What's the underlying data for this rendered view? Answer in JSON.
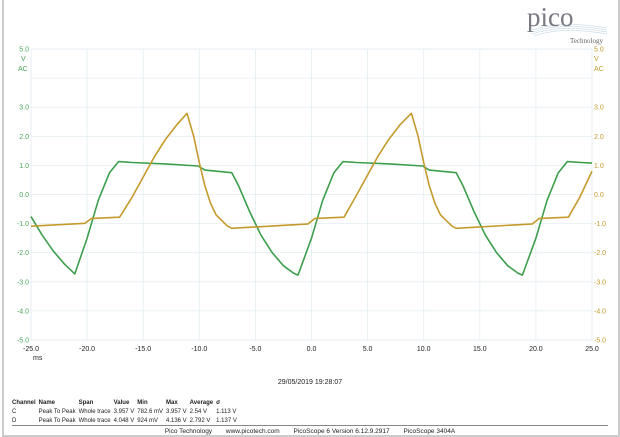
{
  "logo": {
    "text": "pico",
    "subtext": "Technology"
  },
  "chart_data": {
    "type": "line",
    "xlabel": "ms",
    "xlim": [
      -25,
      25
    ],
    "ylim": [
      -5,
      5
    ],
    "grid": true,
    "x_ticks": [
      "-25.0",
      "-20.0",
      "-15.0",
      "-10.0",
      "-5.0",
      "0.0",
      "5.0",
      "10.0",
      "15.0",
      "20.0",
      "25.0"
    ],
    "y_ticks": [
      "5.0",
      "3.0",
      "2.0",
      "1.0",
      "0.0",
      "-1.0",
      "-2.0",
      "-3.0",
      "-4.0",
      "-5.0"
    ],
    "left_axis": {
      "unit": "V",
      "coupling": "AC",
      "color": "#4aa35a"
    },
    "right_axis": {
      "unit": "V",
      "coupling": "AC",
      "color": "#c49a2c"
    },
    "series": [
      {
        "channel": "C",
        "color": "#3d9e4c",
        "points": [
          [
            -25,
            -0.76
          ],
          [
            -24,
            -1.4
          ],
          [
            -23,
            -1.95
          ],
          [
            -22,
            -2.4
          ],
          [
            -21.1,
            -2.73
          ],
          [
            -20,
            -1.5
          ],
          [
            -19,
            -0.2
          ],
          [
            -18,
            0.75
          ],
          [
            -17.2,
            1.13
          ],
          [
            -16,
            1.1
          ],
          [
            -13,
            1.05
          ],
          [
            -10.1,
            0.98
          ],
          [
            -9.5,
            0.84
          ],
          [
            -7.1,
            0.75
          ],
          [
            -6.5,
            0.3
          ],
          [
            -5.5,
            -0.6
          ],
          [
            -4.5,
            -1.4
          ],
          [
            -3.5,
            -2.0
          ],
          [
            -2.5,
            -2.45
          ],
          [
            -1.6,
            -2.7
          ],
          [
            -1.2,
            -2.77
          ],
          [
            0,
            -1.5
          ],
          [
            1,
            -0.2
          ],
          [
            2,
            0.75
          ],
          [
            2.8,
            1.13
          ],
          [
            4,
            1.1
          ],
          [
            7,
            1.05
          ],
          [
            9.9,
            0.98
          ],
          [
            10.5,
            0.84
          ],
          [
            12.9,
            0.75
          ],
          [
            13.5,
            0.3
          ],
          [
            14.5,
            -0.6
          ],
          [
            15.5,
            -1.4
          ],
          [
            16.5,
            -2.0
          ],
          [
            17.5,
            -2.45
          ],
          [
            18.4,
            -2.7
          ],
          [
            18.8,
            -2.77
          ],
          [
            20,
            -1.5
          ],
          [
            21,
            -0.2
          ],
          [
            22,
            0.75
          ],
          [
            22.8,
            1.13
          ],
          [
            24,
            1.1
          ],
          [
            25,
            1.08
          ]
        ]
      },
      {
        "channel": "D",
        "color": "#c49a2c",
        "points": [
          [
            -25,
            -1.09
          ],
          [
            -20.2,
            -0.99
          ],
          [
            -19.6,
            -0.82
          ],
          [
            -17.1,
            -0.78
          ],
          [
            -16,
            -0.1
          ],
          [
            -15,
            0.6
          ],
          [
            -14,
            1.3
          ],
          [
            -13,
            1.9
          ],
          [
            -12,
            2.4
          ],
          [
            -11.1,
            2.79
          ],
          [
            -10.5,
            2.0
          ],
          [
            -10,
            1.1
          ],
          [
            -9.5,
            0.3
          ],
          [
            -9,
            -0.3
          ],
          [
            -8.5,
            -0.7
          ],
          [
            -7.5,
            -1.08
          ],
          [
            -7.1,
            -1.16
          ],
          [
            -0.3,
            -1.01
          ],
          [
            0.3,
            -0.82
          ],
          [
            2.9,
            -0.78
          ],
          [
            3.9,
            -0.1
          ],
          [
            4.9,
            0.6
          ],
          [
            5.9,
            1.3
          ],
          [
            6.9,
            1.9
          ],
          [
            7.9,
            2.4
          ],
          [
            8.9,
            2.79
          ],
          [
            9.5,
            2.0
          ],
          [
            10,
            1.1
          ],
          [
            10.5,
            0.3
          ],
          [
            11,
            -0.3
          ],
          [
            11.5,
            -0.7
          ],
          [
            12.5,
            -1.08
          ],
          [
            12.9,
            -1.16
          ],
          [
            19.7,
            -1.01
          ],
          [
            20.3,
            -0.82
          ],
          [
            22.9,
            -0.78
          ],
          [
            23.9,
            -0.1
          ],
          [
            25,
            0.8
          ]
        ]
      }
    ]
  },
  "timestamp": "29/05/2019 19:28:07",
  "measurements": {
    "headers": [
      "Channel",
      "Name",
      "Span",
      "Value",
      "Min",
      "Max",
      "Average",
      "σ"
    ],
    "rows": [
      [
        "C",
        "Peak To Peak",
        "Whole trace",
        "3.957 V",
        "782.6 mV",
        "3.957 V",
        "2.54 V",
        "1.113 V"
      ],
      [
        "D",
        "Peak To Peak",
        "Whole trace",
        "4.048 V",
        "924 mV",
        "4.136 V",
        "2.792 V",
        "1.137 V"
      ]
    ]
  },
  "footer": {
    "company": "Pico Technology",
    "url": "www.picotech.com",
    "version": "PicoScope 6 Version 6.12.9.2917",
    "device": "PicoScope 3404A"
  }
}
